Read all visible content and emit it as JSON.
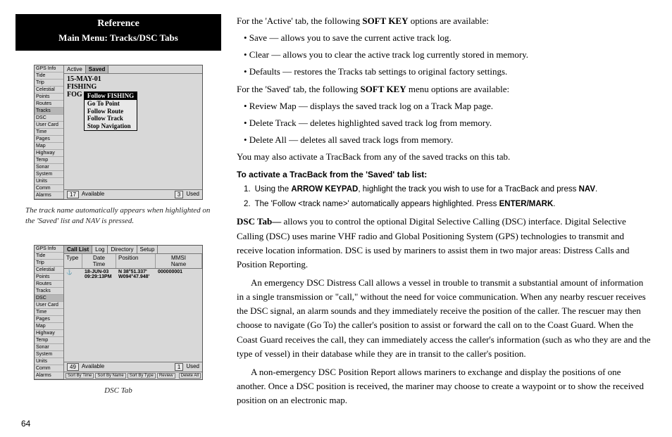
{
  "header": {
    "title": "Reference",
    "subtitle": "Main Menu: Tracks/DSC Tabs"
  },
  "fig1": {
    "tabs": [
      "GPS Info",
      "Tide",
      "Trip",
      "Celestial",
      "Points",
      "Routes",
      "Tracks",
      "DSC",
      "User Card",
      "Time",
      "Pages",
      "Map",
      "Highway",
      "Temp",
      "Sonar",
      "System",
      "Units",
      "Comm",
      "Alarms"
    ],
    "selected_tab": "Tracks",
    "subtabs": {
      "active": "Active",
      "saved": "Saved"
    },
    "tracks": [
      "15-MAY-01",
      "FISHING",
      "FOG"
    ],
    "menu": [
      "Follow FISHING",
      "Go To Point",
      "Follow Route",
      "Follow Track",
      "Stop Navigation"
    ],
    "status": {
      "avail_n": "17",
      "avail_l": "Available",
      "used_n": "3",
      "used_l": "Used"
    },
    "caption": "The track name automatically appears when highlighted on the 'Saved' list and NAV is pressed."
  },
  "fig2": {
    "subtabs": [
      "Call List",
      "Log",
      "Directory",
      "Setup"
    ],
    "headers": {
      "type": "Type",
      "date": "Date",
      "time": "Time",
      "pos": "Position",
      "mmsi": "MMSI",
      "name": "Name"
    },
    "row": {
      "icon": "⚓",
      "date": "18-JUN-03",
      "time": "09:29:13PM",
      "pos1": "N 38°51.337'",
      "pos2": "W094°47.948'",
      "mmsi": "000000001"
    },
    "status": {
      "avail_n": "49",
      "avail_l": "Available",
      "used_n": "1",
      "used_l": "Used"
    },
    "bottom": [
      "Sort By Time",
      "Sort By Name",
      "Sort By Type",
      "Review",
      "Delete All"
    ],
    "caption": "DSC Tab"
  },
  "body": {
    "p1a": "For the 'Active' tab, the following ",
    "p1b": "SOFT KEY",
    "p1c": " options are available:",
    "b1": "• Save — allows you to save the current active track log.",
    "b2": "• Clear — allows you to clear the active track log currently stored in memory.",
    "b3": "• Defaults — restores the Tracks tab settings to original factory settings.",
    "p2a": "For the 'Saved' tab, the following ",
    "p2b": "SOFT KEY",
    "p2c": " menu options are available:",
    "b4": "• Review Map — displays the saved track log on a Track Map page.",
    "b5": "• Delete Track — deletes highlighted saved track log from memory.",
    "b6": "• Delete All — deletes all saved track logs from memory.",
    "p3": "You may also activate a TracBack from any of the saved tracks on this tab.",
    "subhead": "To activate a TracBack from the 'Saved' tab list:",
    "s1a": "Using the ",
    "s1b": "ARROW KEYPAD",
    "s1c": ", highlight the track you wish to use for a TracBack and press ",
    "s1d": "NAV",
    "s1e": ".",
    "s2a": "The 'Follow <track name>' automatically appears highlighted. Press ",
    "s2b": "ENTER/MARK",
    "s2c": ".",
    "p4a": "DSC Tab—",
    "p4b": " allows you to control the optional Digital Selective Calling (DSC) interface. Digital Selective Calling (DSC) uses marine VHF radio and Global Positioning System (GPS) technologies to transmit and receive location information. DSC is used by mariners to assist them in two major areas: Distress Calls and Position Reporting.",
    "p5": "An emergency DSC Distress Call allows a vessel in trouble to transmit a substantial amount of information in a single transmission or \"call,\" without the need for voice communication. When any nearby rescuer receives the DSC signal, an alarm sounds and they immediately receive the position of the caller. The rescuer may then choose to navigate (Go To) the caller's position to assist or forward the call on to the Coast Guard. When the Coast Guard receives the call, they can immediately access the caller's information (such as who they are and the type of vessel) in their database while they are in transit to the caller's position.",
    "p6": "A non-emergency DSC Position Report allows mariners to exchange and display the positions of one another. Once a DSC position is received, the mariner may choose to create a waypoint or to show the received position on an electronic map."
  },
  "pagenum": "64"
}
